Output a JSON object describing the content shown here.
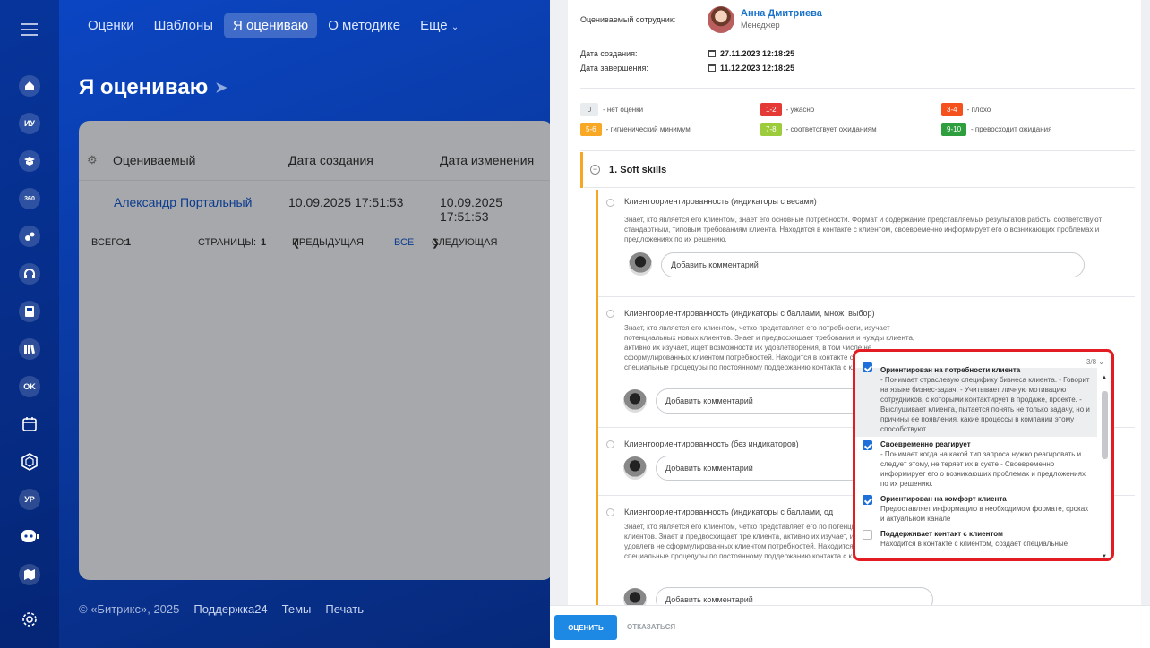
{
  "nav": {
    "tabs": [
      "Оценки",
      "Шаблоны",
      "Я оцениваю",
      "О методике",
      "Еще"
    ],
    "active_tab": "Я оцениваю"
  },
  "rail": {
    "badges": {
      "iu": "ИУ",
      "r360": "360",
      "ok": "OK",
      "ur": "УР"
    },
    "icons": [
      "home-icon",
      "iu-badge",
      "graduation-cap-icon",
      "360-icon",
      "feed-icon",
      "headset-icon",
      "book-icon",
      "library-icon",
      "ok-badge",
      "calendar-icon",
      "hexagon-icon",
      "ur-badge",
      "chat-bot-icon",
      "map-icon",
      "settings-icon"
    ]
  },
  "page": {
    "title": "Я оцениваю"
  },
  "table": {
    "columns": [
      "Оцениваемый",
      "Дата создания",
      "Дата изменения"
    ],
    "rows": [
      {
        "name": "Александр Портальный",
        "created": "10.09.2025 17:51:53",
        "modified": "10.09.2025 17:51:53"
      }
    ]
  },
  "pager": {
    "total_label": "ВСЕГО:",
    "total": "1",
    "pages_label": "СТРАНИЦЫ:",
    "page": "1",
    "prev": "ПРЕДЫДУЩАЯ",
    "all": "ВСЕ",
    "next": "СЛЕДУЮЩАЯ"
  },
  "footer": {
    "copyright": "© «Битрикс», 2025",
    "links": [
      "Поддержка24",
      "Темы",
      "Печать"
    ]
  },
  "review": {
    "employee_label": "Оцениваемый сотрудник:",
    "employee_name": "Анна Дмитриева",
    "employee_role": "Менеджер",
    "created_label": "Дата создания:",
    "created": "27.11.2023 12:18:25",
    "finished_label": "Дата завершения:",
    "finished": "11.12.2023 12:18:25",
    "legend": [
      {
        "badge": "0",
        "text": "- нет оценки",
        "color": "#e9ecef",
        "text_color": "#666666"
      },
      {
        "badge": "1-2",
        "text": "- ужасно",
        "color": "#e53935",
        "text_color": "#ffffff"
      },
      {
        "badge": "3-4",
        "text": "- плохо",
        "color": "#f4511e",
        "text_color": "#ffffff"
      },
      {
        "badge": "5-6",
        "text": "- гигиенический минимум",
        "color": "#f9a825",
        "text_color": "#ffffff"
      },
      {
        "badge": "7-8",
        "text": "- соответствует ожиданиям",
        "color": "#9ccc3c",
        "text_color": "#ffffff"
      },
      {
        "badge": "9-10",
        "text": "- превосходит ожидания",
        "color": "#2e9e3e",
        "text_color": "#ffffff"
      }
    ],
    "section_title": "1. Soft skills",
    "questions": [
      {
        "title": "Клиентоориентированность (индикаторы с весами)",
        "desc": "Знает, кто является его клиентом, знает его основные потребности. Формат и содержание представляемых результатов работы соответствуют стандартным, типовым требованиям клиента. Находится в контакте с клиентом, своевременно информирует его о возникающих проблемах и предложениях по их решению.",
        "comment_placeholder": "Добавить комментарий"
      },
      {
        "title": "Клиентоориентированность (индикаторы с баллами, множ. выбор)",
        "desc": "Знает, кто является его клиентом, четко представляет его потребности, изучает потенциальных новых клиентов. Знает и предвосхищает требования и нужды клиента, активно их изучает, ищет возможности их удовлетворения, в том числе не сформулированных клиентом потребностей. Находится в контакте с клиентом, создает специальные процедуры по постоянному поддержанию контакта с клиентом.",
        "comment_placeholder": "Добавить комментарий"
      },
      {
        "title": "Клиентоориентированность (без индикаторов)",
        "desc": "",
        "comment_placeholder": "Добавить комментарий"
      },
      {
        "title": "Клиентоориентированность (индикаторы с баллами, од",
        "desc": "Знает, кто является его клиентом, четко представляет его по потенциальных новых клиентов. Знает и предвосхищает тре клиента, активно их изучает, ищет возможности их удовлетв не сформулированных клиентом потребностей. Находится в создает специальные процедуры по постоянному поддержанию контакта с клиентом.",
        "comment_placeholder": "Добавить комментарий"
      }
    ],
    "dropdown": {
      "count": "3/8",
      "options": [
        {
          "title": "Ориентирован на потребности клиента",
          "desc": "- Понимает отраслевую специфику бизнеса клиента. - Говорит на языке бизнес-задач. - Учитывает личную мотивацию сотрудников, с которыми контактирует в продаже, проекте. - Выслушивает клиента, пытается понять не только задачу, но и причины ее появления, какие процессы в компании этому способствуют.",
          "checked": true
        },
        {
          "title": "Своевременно реагирует",
          "desc": "- Понимает когда на какой тип запроса нужно реагировать и следует этому, не теряет их в суете - Своевременно информирует его о возникающих проблемах и предложениях по их решению.",
          "checked": true
        },
        {
          "title": "Ориентирован на комфорт клиента",
          "desc": "Предоставляет информацию в необходимом формате, сроках и актуальном канале",
          "checked": true
        },
        {
          "title": "Поддерживает контакт с клиентом",
          "desc": "Находится в контакте с клиентом, создает специальные",
          "checked": false
        }
      ]
    },
    "buttons": {
      "submit": "ОЦЕНИТЬ",
      "cancel": "ОТКАЗАТЬСЯ"
    }
  }
}
